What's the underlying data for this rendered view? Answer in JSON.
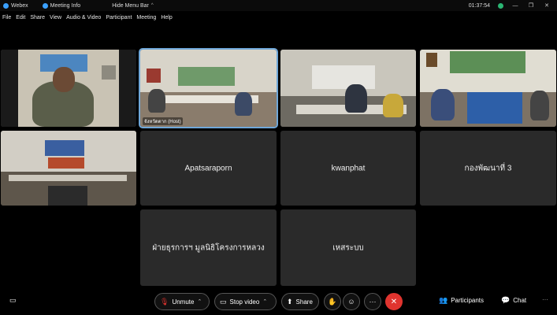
{
  "titlebar": {
    "app_name": "Webex",
    "meeting_info": "Meeting Info",
    "hide_menu_bar": "Hide Menu Bar",
    "time": "01:37:54"
  },
  "menu": {
    "items": [
      "File",
      "Edit",
      "Share",
      "View",
      "Audio & Video",
      "Participant",
      "Meeting",
      "Help"
    ]
  },
  "participants": {
    "host_label": "จังหวัดตาก (Host)",
    "tiles": [
      "Apatsaraporn",
      "kwanphat",
      "กองพัฒนาที่ 3",
      "ฝ่ายธุรการฯ มูลนิธิโครงการหลวง",
      "เหสระบบ"
    ]
  },
  "controls": {
    "unmute": "Unmute",
    "stop_video": "Stop video",
    "share": "Share",
    "participants": "Participants",
    "chat": "Chat",
    "more": "···"
  },
  "colors": {
    "accent_blue": "#6fa7d9",
    "end_red": "#e0342f",
    "unmute_red": "#e0342f"
  }
}
